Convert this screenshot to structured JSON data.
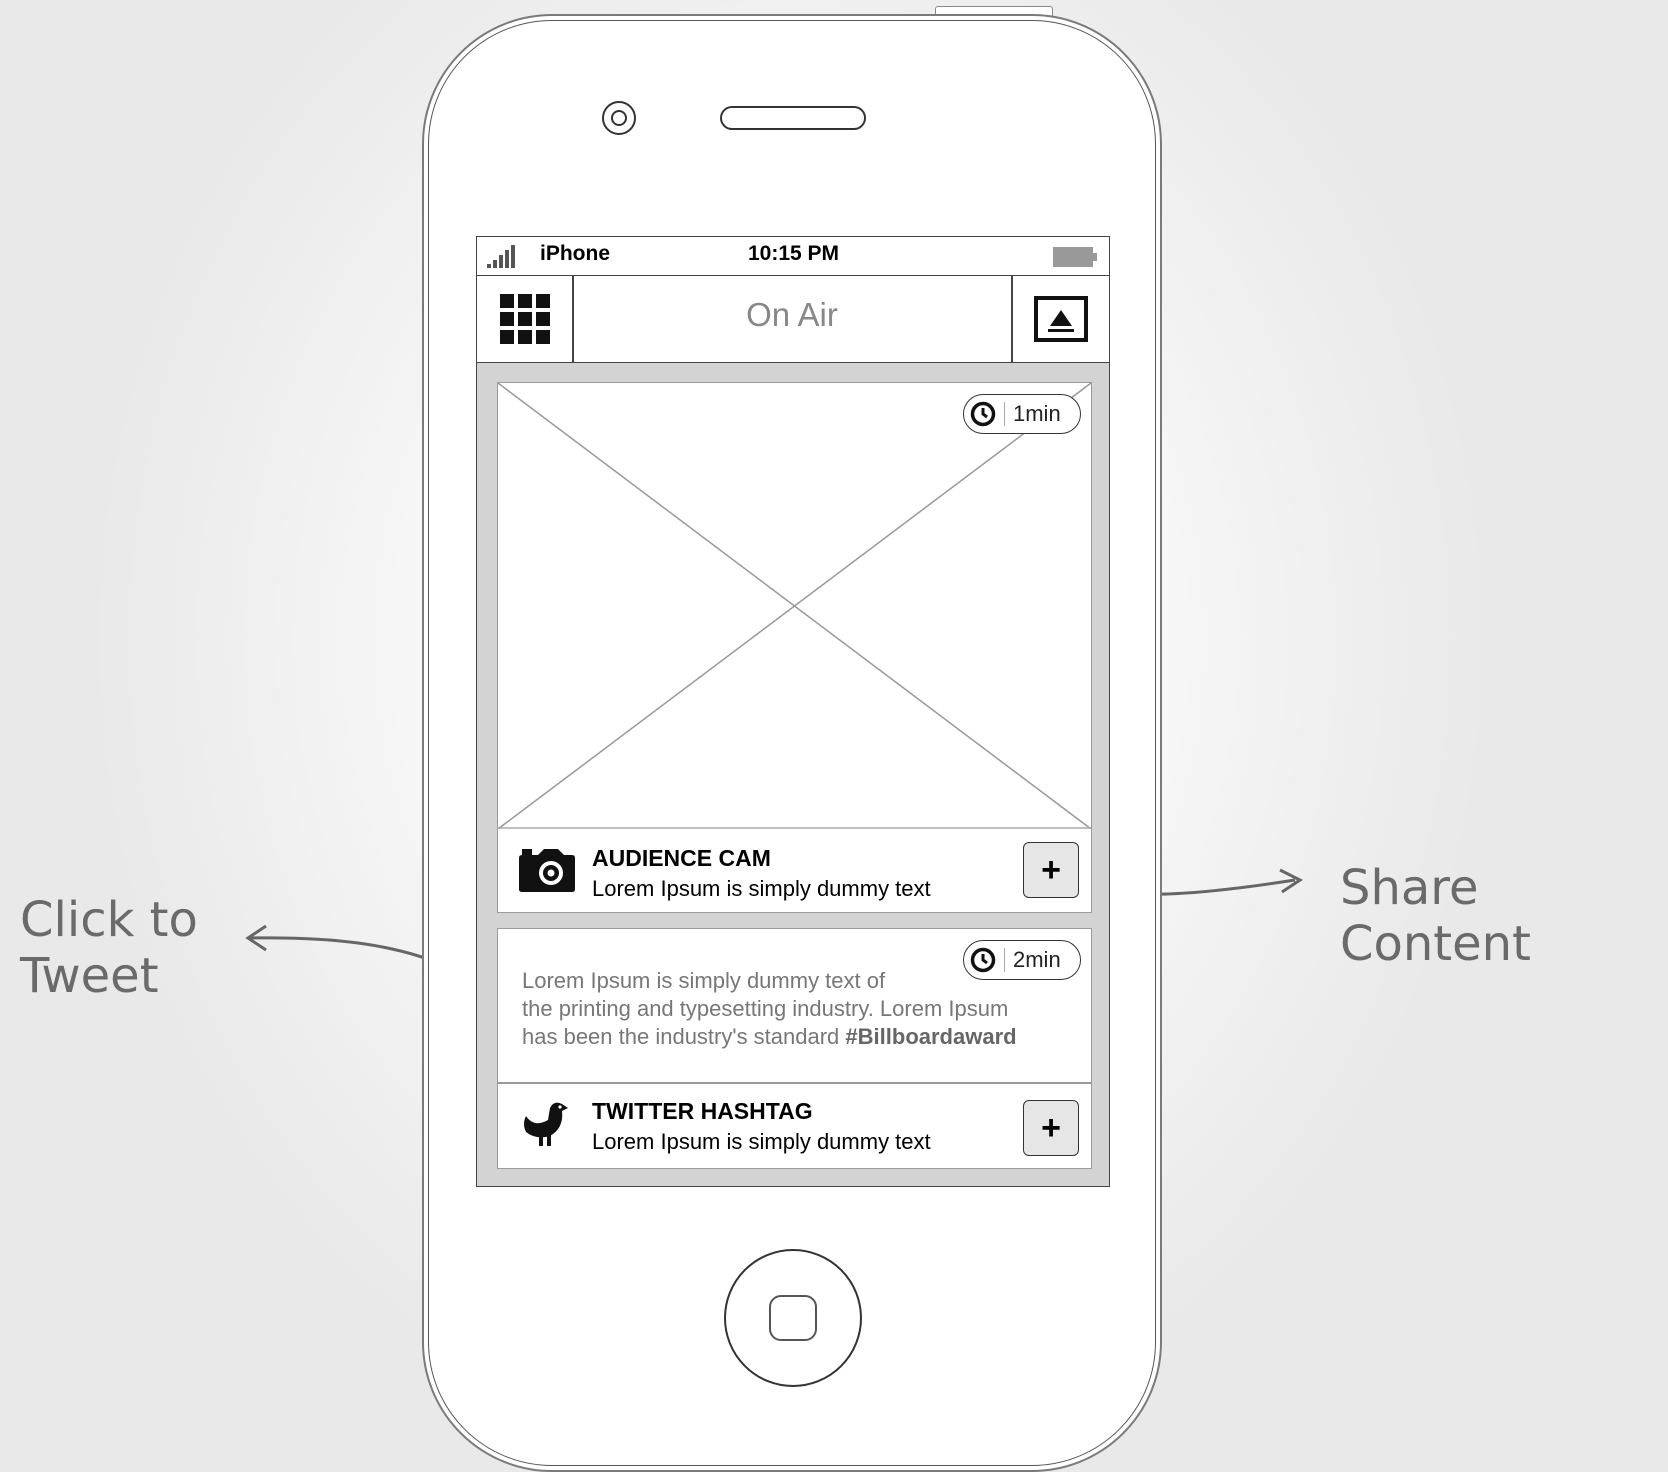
{
  "annotations": {
    "click_to_tweet_line1": "Click to",
    "click_to_tweet_line2": "Tweet",
    "share_content": "Share Content"
  },
  "statusbar": {
    "carrier": "iPhone",
    "time": "10:15 PM"
  },
  "navbar": {
    "title": "On Air",
    "left_icon": "grid-menu-icon",
    "right_icon": "airplay-icon"
  },
  "feed": {
    "audience_cam": {
      "time_ago": "1min",
      "title": "AUDIENCE CAM",
      "subtitle": "Lorem Ipsum is simply dummy text",
      "action_label": "+",
      "icon": "camera-icon"
    },
    "twitter": {
      "time_ago": "2min",
      "tweet_line1": "Lorem Ipsum is simply dummy text of",
      "tweet_line2": "the printing and typesetting industry. Lorem Ipsum",
      "tweet_line3": "has been the industry's standard",
      "hashtag": "#Billboardaward",
      "title": "TWITTER HASHTAG",
      "subtitle": "Lorem Ipsum is simply dummy text",
      "action_label": "+",
      "icon": "bird-icon"
    }
  }
}
